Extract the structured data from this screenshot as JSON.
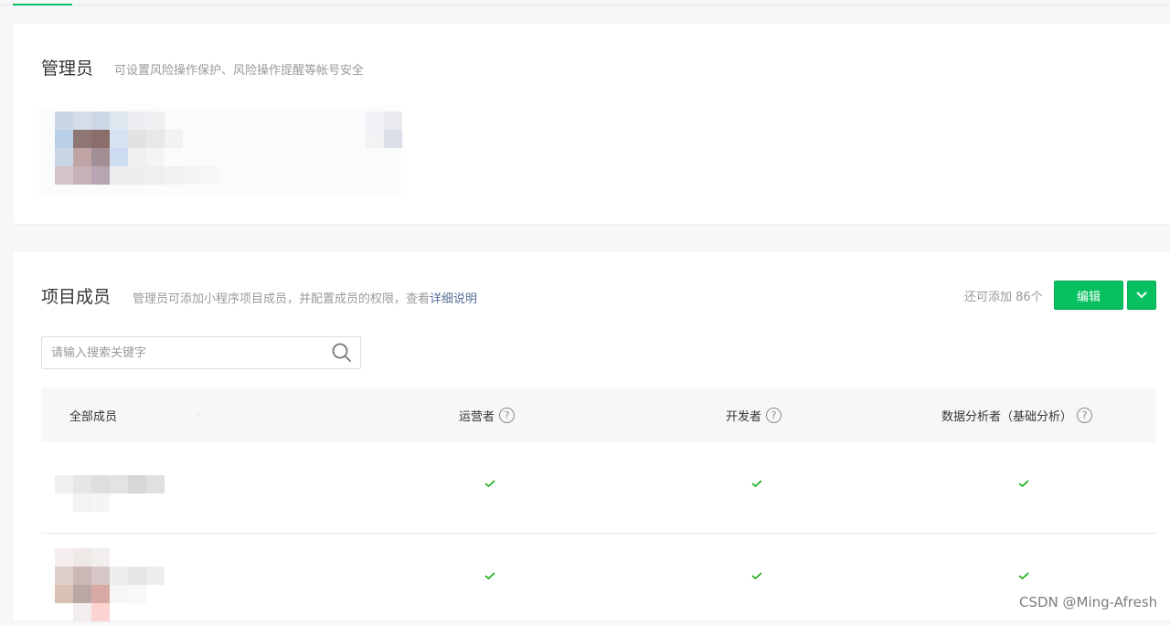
{
  "admin_section": {
    "title": "管理员",
    "description": "可设置风险操作保护、风险操作提醒等帐号安全"
  },
  "members_section": {
    "title": "项目成员",
    "description_prefix": "管理员可添加小程序项目成员，并配置成员的权限，查看",
    "description_link": "详细说明",
    "remaining_label": "还可添加 86个",
    "edit_button": "编辑",
    "search": {
      "placeholder": "请输入搜索关键字",
      "value": ""
    },
    "table": {
      "columns": [
        {
          "label": "全部成员",
          "help": false
        },
        {
          "label": "运营者",
          "help": true
        },
        {
          "label": "开发者",
          "help": true
        },
        {
          "label": "数据分析者（基础分析）",
          "help": true
        }
      ],
      "rows": [
        {
          "member": "",
          "operator": true,
          "developer": true,
          "data_analyst": true
        },
        {
          "member": "",
          "operator": true,
          "developer": true,
          "data_analyst": true
        }
      ]
    }
  },
  "watermark": "CSDN @Ming-Afresh",
  "colors": {
    "accent": "#07c160",
    "link": "#576b95",
    "muted_text": "#9a9a9a",
    "check": "#1aad19"
  },
  "icons": {
    "search": "search-icon",
    "dropdown": "chevron-down-icon",
    "help": "question-circle-icon",
    "check": "check-icon"
  }
}
